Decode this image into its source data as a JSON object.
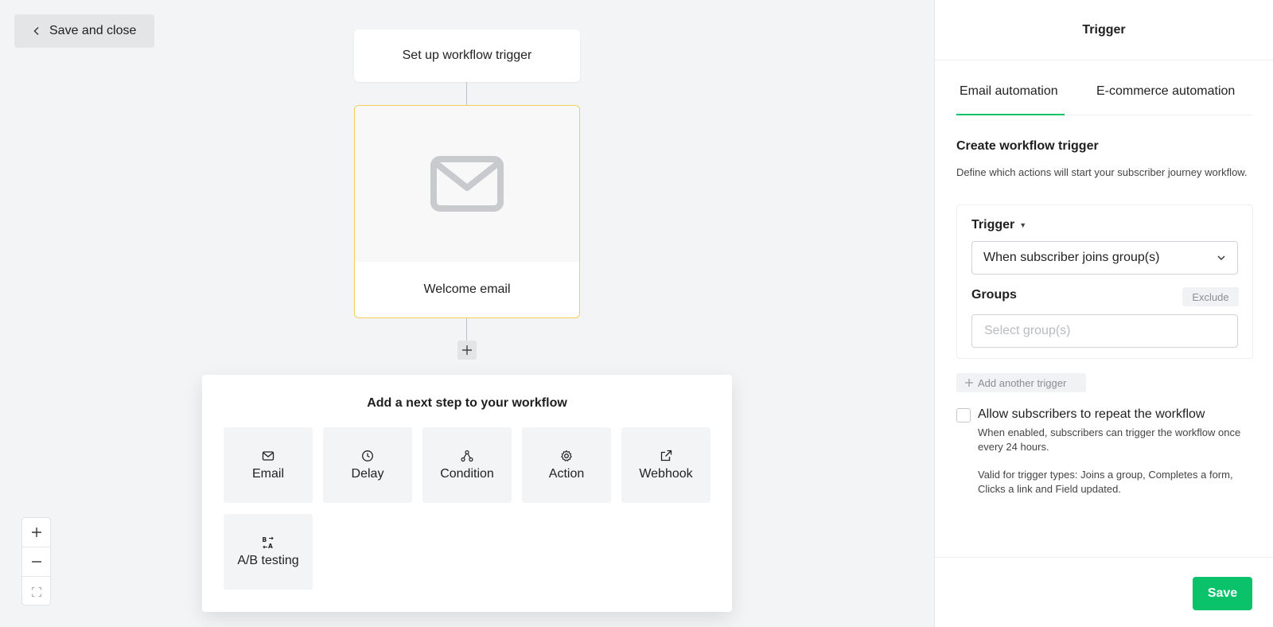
{
  "canvas": {
    "save_close_label": "Save and close",
    "trigger_node_label": "Set up workflow trigger",
    "email_node_label": "Welcome email",
    "step_panel": {
      "title": "Add a next step to your workflow",
      "steps": [
        {
          "label": "Email",
          "icon": "mail-icon"
        },
        {
          "label": "Delay",
          "icon": "clock-icon"
        },
        {
          "label": "Condition",
          "icon": "branch-icon"
        },
        {
          "label": "Action",
          "icon": "gear-icon"
        },
        {
          "label": "Webhook",
          "icon": "external-link-icon"
        },
        {
          "label": "A/B testing",
          "icon": "ab-test-icon"
        }
      ]
    }
  },
  "sidebar": {
    "title": "Trigger",
    "tabs": [
      {
        "label": "Email automation",
        "active": true
      },
      {
        "label": "E-commerce automation",
        "active": false
      }
    ],
    "section_title": "Create workflow trigger",
    "section_desc": "Define which actions will start your subscriber journey workflow.",
    "trigger_label": "Trigger",
    "trigger_value": "When subscriber joins group(s)",
    "groups_label": "Groups",
    "exclude_label": "Exclude",
    "groups_placeholder": "Select group(s)",
    "add_trigger_label": "Add another trigger",
    "repeat_label": "Allow subscribers to repeat the workflow",
    "repeat_desc1": "When enabled, subscribers can trigger the workflow once every 24 hours.",
    "repeat_desc2": "Valid for trigger types: Joins a group, Completes a form, Clicks a link and Field updated.",
    "save_label": "Save"
  },
  "colors": {
    "accent": "#09c269",
    "node_highlight": "#f1cd5a",
    "canvas_bg": "#f3f4f5"
  }
}
